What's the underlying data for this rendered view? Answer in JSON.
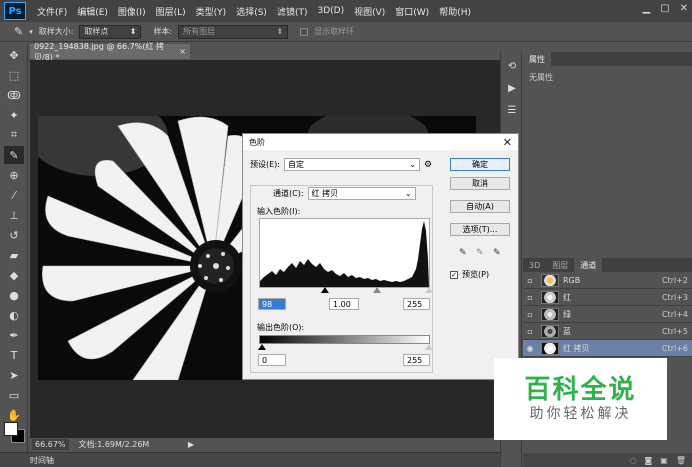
{
  "app": {
    "logo": "Ps"
  },
  "menu": [
    "文件(F)",
    "编辑(E)",
    "图像(I)",
    "图层(L)",
    "类型(Y)",
    "选择(S)",
    "滤镜(T)",
    "3D(D)",
    "视图(V)",
    "窗口(W)",
    "帮助(H)"
  ],
  "options": {
    "sample_size_label": "取样大小:",
    "sample_size_value": "取样点",
    "sample_label": "样本:",
    "sample_value": "所有图层",
    "show_ring_label": "显示取样环"
  },
  "doc": {
    "tab": "0922_194838.jpg @ 66.7%(红 拷贝/8) *",
    "tab_close": "×"
  },
  "status": {
    "zoom": "66.67%",
    "doc_info": "文档:1.69M/2.26M",
    "timeline": "时间轴"
  },
  "panels": {
    "properties_tab": "属性",
    "no_properties": "无属性",
    "tab_3d": "3D",
    "tab_layers": "图层",
    "tab_channels": "通道"
  },
  "channels": [
    {
      "name": "RGB",
      "key": "Ctrl+2",
      "selected": false
    },
    {
      "name": "红",
      "key": "Ctrl+3",
      "selected": false
    },
    {
      "name": "绿",
      "key": "Ctrl+4",
      "selected": false
    },
    {
      "name": "蓝",
      "key": "Ctrl+5",
      "selected": false
    },
    {
      "name": "红 拷贝",
      "key": "Ctrl+6",
      "selected": true
    }
  ],
  "levels": {
    "title": "色阶",
    "preset_label": "预设(E):",
    "preset_value": "自定",
    "channel_label": "通道(C):",
    "channel_value": "红 拷贝",
    "input_label": "输入色阶(I):",
    "input_black": "98",
    "input_gamma": "1.00",
    "input_white": "255",
    "output_label": "输出色阶(O):",
    "output_black": "0",
    "output_white": "255",
    "ok": "确定",
    "cancel": "取消",
    "auto": "自动(A)",
    "options": "选项(T)...",
    "preview": "预览(P)",
    "preview_checked": true
  },
  "watermark": {
    "main": "百科全说",
    "sub": "助你轻松解决"
  }
}
